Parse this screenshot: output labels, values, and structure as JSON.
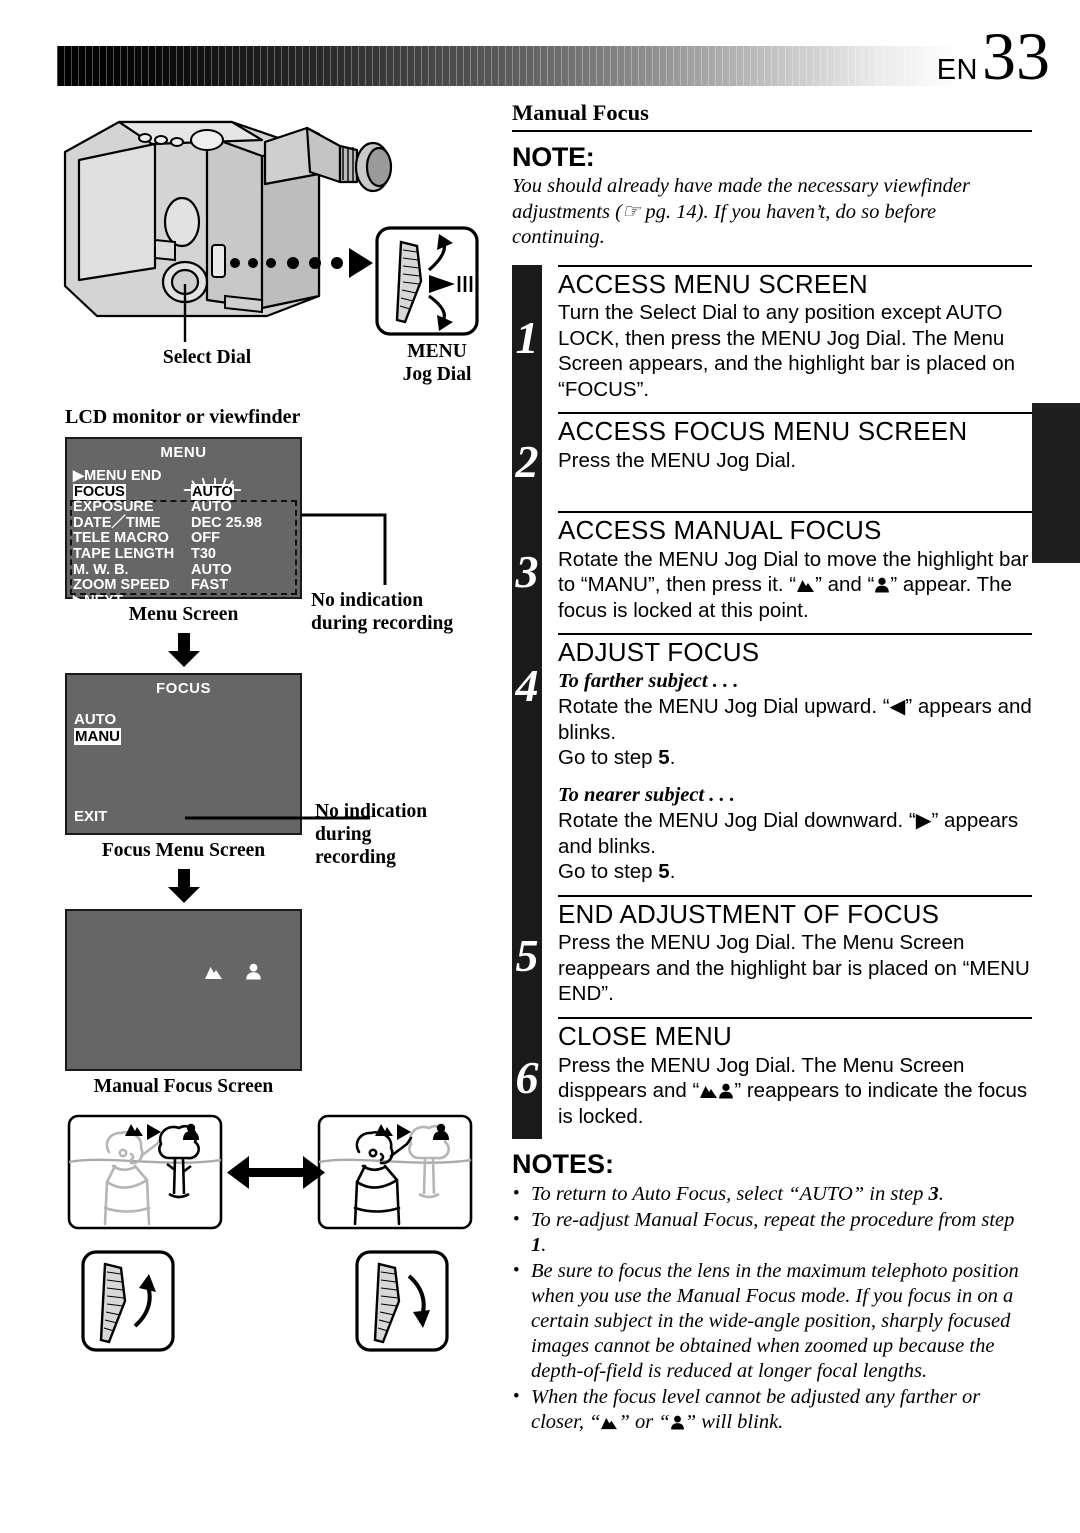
{
  "header": {
    "lang": "EN",
    "page": "33"
  },
  "left": {
    "lcd_caption": "LCD monitor or viewfinder",
    "labels": {
      "select_dial": "Select Dial",
      "menu_jog_dial_line1": "MENU",
      "menu_jog_dial_line2": "Jog Dial"
    },
    "menu_screen": {
      "title": "MENU",
      "caption": "Menu Screen",
      "rows": [
        {
          "item": "▶MENU  END",
          "value": "",
          "item_hl": false,
          "value_hl": false,
          "blink": false
        },
        {
          "item": "FOCUS",
          "value": "AUTO",
          "item_hl": true,
          "value_hl": true,
          "blink": true
        },
        {
          "item": "EXPOSURE",
          "value": "AUTO",
          "item_hl": false,
          "value_hl": false,
          "blink": false
        },
        {
          "item": "DATE／TIME",
          "value": "DEC 25.98",
          "item_hl": false,
          "value_hl": false,
          "blink": false
        },
        {
          "item": "TELE  MACRO",
          "value": "OFF",
          "item_hl": false,
          "value_hl": false,
          "blink": false
        },
        {
          "item": "TAPE  LENGTH",
          "value": "T30",
          "item_hl": false,
          "value_hl": false,
          "blink": false
        },
        {
          "item": "M. W. B.",
          "value": "AUTO",
          "item_hl": false,
          "value_hl": false,
          "blink": false
        },
        {
          "item": "ZOOM SPEED",
          "value": "FAST",
          "item_hl": false,
          "value_hl": false,
          "blink": false
        },
        {
          "item": "▶NEXT",
          "value": "",
          "item_hl": false,
          "value_hl": false,
          "blink": false
        }
      ]
    },
    "focus_screen": {
      "title": "FOCUS",
      "caption": "Focus Menu Screen",
      "option_auto": "AUTO",
      "option_manu": "MANU",
      "exit": "EXIT"
    },
    "manual_focus_screen": {
      "caption": "Manual Focus Screen"
    },
    "callouts": {
      "no_indication_1": "No indication\nduring recording",
      "no_indication_2": "No indication\nduring\nrecording"
    }
  },
  "right": {
    "section_title": "Manual Focus",
    "note_heading": "NOTE:",
    "note_body": "You should already have made the necessary viewfinder adjustments (☞ pg. 14). If you haven’t, do so before continuing.",
    "steps": [
      {
        "num": "1",
        "title": "ACCESS MENU SCREEN",
        "body": "Turn the Select Dial to any position except AUTO LOCK, then press the MENU Jog Dial. The Menu Screen appears, and the highlight bar is placed on “FOCUS”."
      },
      {
        "num": "2",
        "title": "ACCESS FOCUS MENU SCREEN",
        "body": "Press the MENU Jog Dial."
      },
      {
        "num": "3",
        "title": "ACCESS MANUAL FOCUS",
        "body_pre": "Rotate the MENU Jog Dial to move the highlight bar to “MANU”, then press it. “",
        "body_mid": "” and “",
        "body_post": "” appear. The focus is locked at this point."
      },
      {
        "num": "4",
        "title": "ADJUST FOCUS",
        "sub1_head": "To farther subject . . .",
        "sub1_body": "Rotate the MENU Jog Dial upward. “◀” appears and blinks.",
        "sub1_goto_pre": "Go to step ",
        "sub1_goto_num": "5",
        "sub1_goto_post": ".",
        "sub2_head": "To nearer subject . . .",
        "sub2_body": "Rotate the MENU Jog Dial downward. “▶” appears and blinks.",
        "sub2_goto_pre": "Go to step ",
        "sub2_goto_num": "5",
        "sub2_goto_post": "."
      },
      {
        "num": "5",
        "title": "END ADJUSTMENT OF FOCUS",
        "body": "Press the MENU Jog Dial. The Menu Screen reappears and the highlight bar is placed on “MENU END”."
      },
      {
        "num": "6",
        "title": "CLOSE MENU",
        "body_pre": "Press the MENU Jog Dial. The Menu Screen disppears and “",
        "body_post": "” reappears to indicate the focus is locked."
      }
    ],
    "notes_heading": "NOTES:",
    "notes": [
      {
        "pre": "To return to Auto Focus, select “AUTO” in step ",
        "strong": "3",
        "post": "."
      },
      {
        "pre": "To re-adjust Manual Focus, repeat the procedure from step ",
        "strong": "1",
        "post": "."
      },
      {
        "pre": "Be sure to focus the lens in the maximum telephoto position when you use the Manual Focus mode. If you focus in on a certain subject in the wide-angle position, sharply focused images cannot be obtained when zoomed up because the depth-of-field is reduced at longer focal lengths.",
        "strong": "",
        "post": ""
      },
      {
        "pre": "When the focus level cannot be adjusted any farther or closer, “",
        "mid": "” or “",
        "post": "” will blink.",
        "icons": true
      }
    ]
  },
  "colors": {
    "screen_bg": "#666666",
    "ink": "#000000",
    "step_bar": "#1a1a1a"
  }
}
